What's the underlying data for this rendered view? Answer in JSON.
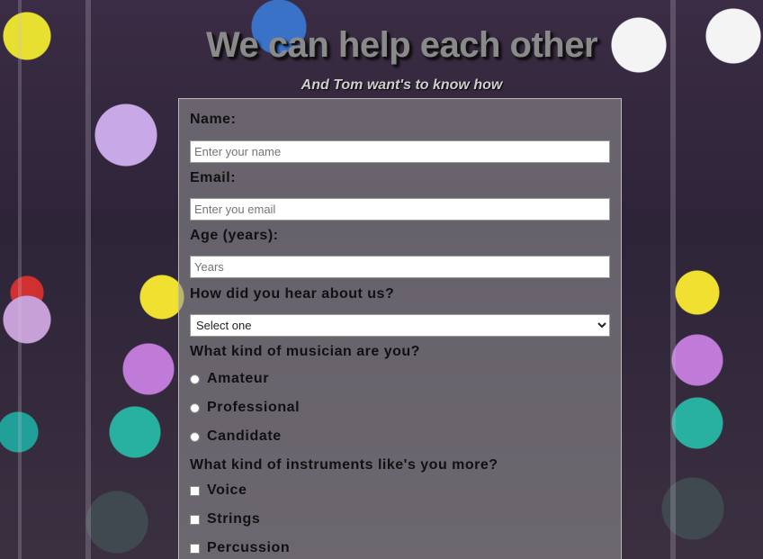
{
  "header": {
    "title": "We can help each other",
    "subtitle": "And Tom want's to know how"
  },
  "form": {
    "name": {
      "label": "Name:",
      "placeholder": "Enter your name",
      "value": ""
    },
    "email": {
      "label": "Email:",
      "placeholder": "Enter you email",
      "value": ""
    },
    "age": {
      "label": "Age (years):",
      "placeholder": "Years",
      "value": ""
    },
    "referral": {
      "label": "How did you hear about us?",
      "selected": "Select one"
    },
    "musician_type": {
      "label": "What kind of musician are you?",
      "options": [
        {
          "label": "Amateur",
          "selected": false
        },
        {
          "label": "Professional",
          "selected": false
        },
        {
          "label": "Candidate",
          "selected": false
        }
      ]
    },
    "instruments": {
      "label": "What kind of instruments like's you more?",
      "options": [
        {
          "label": "Voice",
          "checked": false
        },
        {
          "label": "Strings",
          "checked": false
        },
        {
          "label": "Percussion",
          "checked": false
        }
      ]
    }
  },
  "colors": {
    "title_text": "#8a8a8a",
    "panel_overlay": "#969696",
    "label_text": "#111111",
    "input_background": "#ffffff"
  }
}
